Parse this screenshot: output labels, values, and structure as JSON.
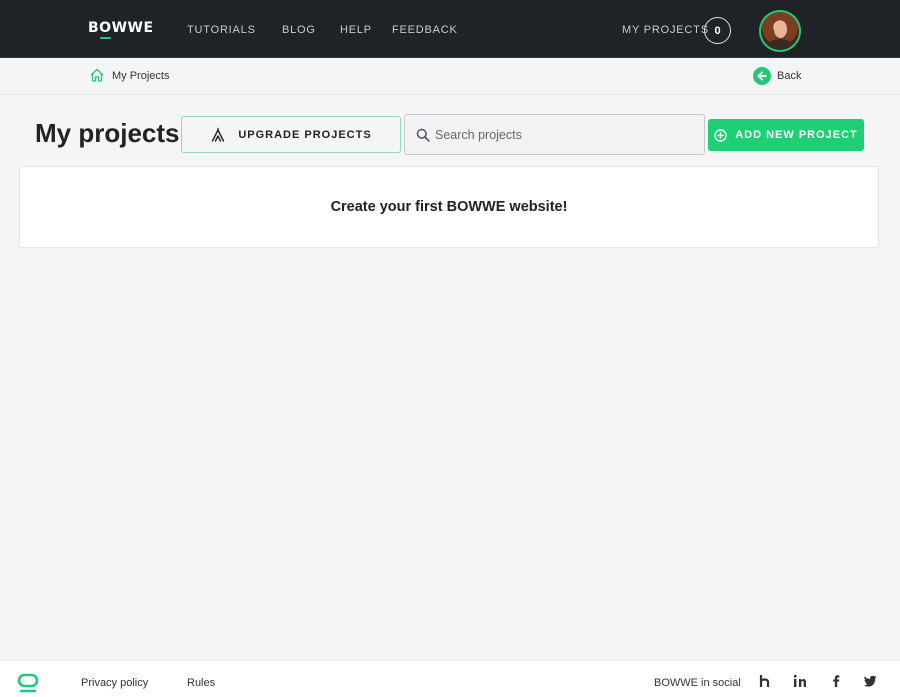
{
  "nav": {
    "logo": "BOWWE",
    "links": [
      {
        "label": "TUTORIALS"
      },
      {
        "label": "BLOG"
      },
      {
        "label": "HELP"
      },
      {
        "label": "FEEDBACK"
      }
    ],
    "my_projects_label": "MY PROJECTS",
    "project_count": "0"
  },
  "breadcrumb": {
    "current": "My Projects",
    "back_label": "Back"
  },
  "header": {
    "title": "My projects",
    "upgrade_label": "UPGRADE PROJECTS",
    "search_placeholder": "Search projects",
    "add_label": "ADD NEW PROJECT"
  },
  "empty_state": {
    "message": "Create your first BOWWE website!"
  },
  "footer": {
    "privacy_label": "Privacy policy",
    "rules_label": "Rules",
    "social_label": "BOWWE in social"
  },
  "colors": {
    "accent": "#1fcf75",
    "nav_bg": "#1f2226",
    "page_bg": "#f5f5f7"
  }
}
